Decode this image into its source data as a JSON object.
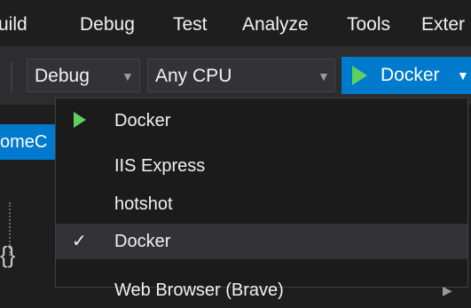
{
  "menubar": {
    "items": [
      "uild",
      "Debug",
      "Test",
      "Analyze",
      "Tools",
      "Exter"
    ]
  },
  "toolbar": {
    "config_combo": {
      "value": "Debug"
    },
    "platform_combo": {
      "value": "Any CPU"
    },
    "run_button": {
      "label": "Docker"
    }
  },
  "editor": {
    "doc_tab_label": "omeC",
    "brace_glyph": "{}"
  },
  "dropdown": {
    "items": [
      {
        "label": "Docker",
        "icon": "play-icon"
      },
      {
        "label": "IIS Express"
      },
      {
        "label": "hotshot"
      },
      {
        "label": "Docker",
        "checked": true,
        "check_glyph": "✓"
      },
      {
        "label": "Web Browser (Brave)",
        "has_submenu": true
      }
    ]
  },
  "colors": {
    "accent": "#007acc",
    "play_green": "#5fd05f",
    "background": "#1e1e1e"
  }
}
